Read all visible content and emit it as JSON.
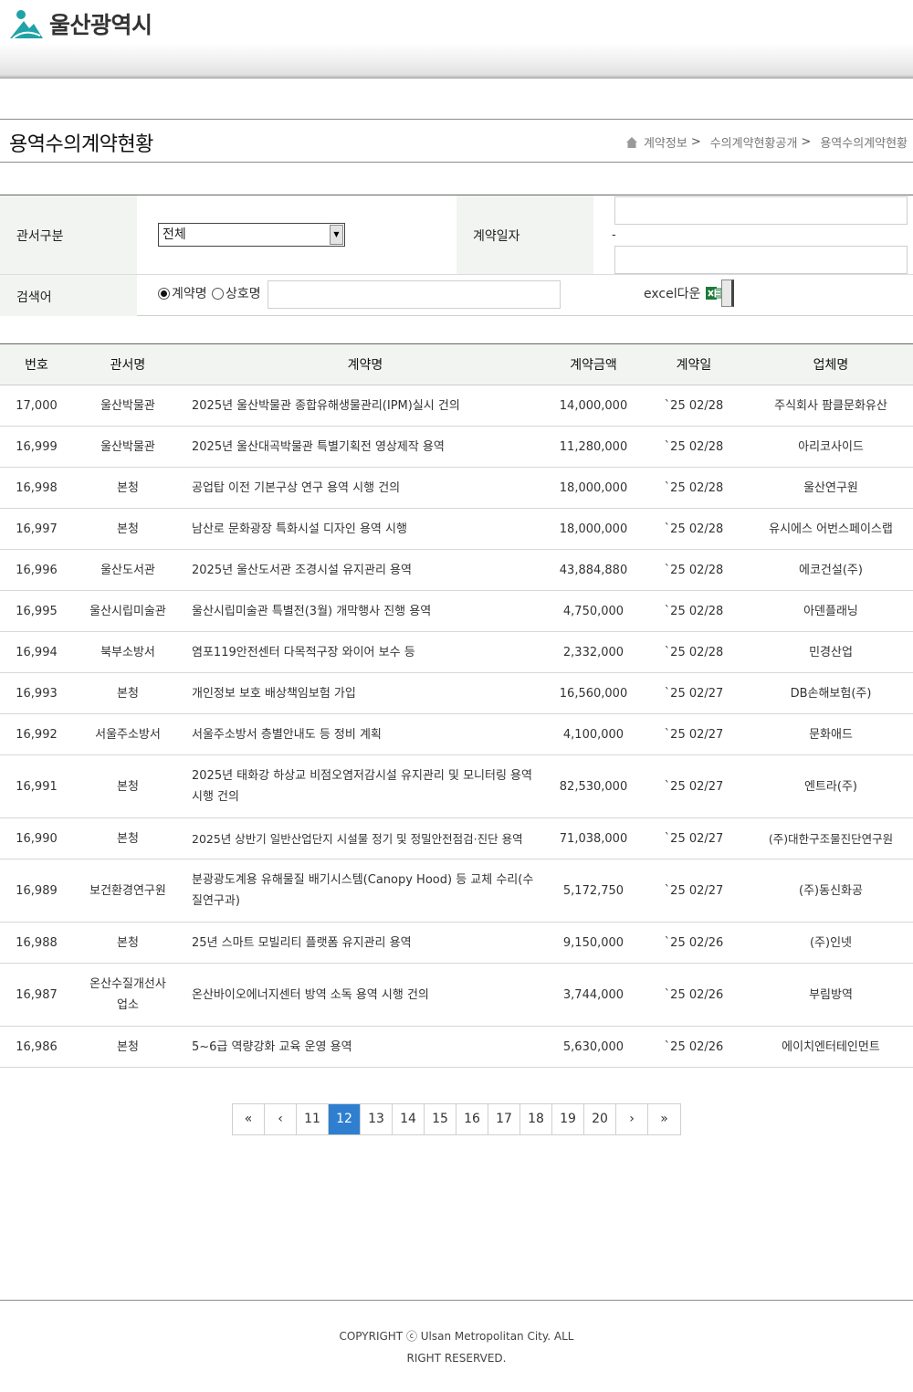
{
  "header": {
    "logo_text": "울산광역시"
  },
  "page": {
    "title": "용역수의계약현황",
    "breadcrumb": [
      "계약정보",
      "수의계약현황공개",
      "용역수의계약현황"
    ]
  },
  "search": {
    "dept_label": "관서구분",
    "dept_selected": "전체",
    "date_label": "계약일자",
    "date_separator": "-",
    "keyword_label": "검색어",
    "radio_contract": "계약명",
    "radio_company": "상호명",
    "excel_label": "excel다운"
  },
  "table": {
    "columns": [
      "번호",
      "관서명",
      "계약명",
      "계약금액",
      "계약일",
      "업체명"
    ],
    "rows": [
      {
        "no": "17,000",
        "dept": "울산박물관",
        "name": "2025년 울산박물관 종합유해생물관리(IPM)실시 건의",
        "amount": "14,000,000",
        "date": "`25 02/28",
        "company": "주식회사 팜클문화유산"
      },
      {
        "no": "16,999",
        "dept": "울산박물관",
        "name": "2025년 울산대곡박물관 특별기획전 영상제작 용역",
        "amount": "11,280,000",
        "date": "`25 02/28",
        "company": "아리코사이드"
      },
      {
        "no": "16,998",
        "dept": "본청",
        "name": "공업탑 이전 기본구상 연구 용역 시행 건의",
        "amount": "18,000,000",
        "date": "`25 02/28",
        "company": "울산연구원"
      },
      {
        "no": "16,997",
        "dept": "본청",
        "name": "남산로 문화광장 특화시설 디자인 용역 시행",
        "amount": "18,000,000",
        "date": "`25 02/28",
        "company": "유시에스 어번스페이스랩"
      },
      {
        "no": "16,996",
        "dept": "울산도서관",
        "name": "2025년 울산도서관 조경시설 유지관리 용역",
        "amount": "43,884,880",
        "date": "`25 02/28",
        "company": "에코건설(주)"
      },
      {
        "no": "16,995",
        "dept": "울산시립미술관",
        "name": "울산시립미술관 특별전(3월) 개막행사 진행 용역",
        "amount": "4,750,000",
        "date": "`25 02/28",
        "company": "아덴플래닝"
      },
      {
        "no": "16,994",
        "dept": "북부소방서",
        "name": "염포119안전센터 다목적구장 와이어 보수 등",
        "amount": "2,332,000",
        "date": "`25 02/28",
        "company": "민경산업"
      },
      {
        "no": "16,993",
        "dept": "본청",
        "name": "개인정보 보호 배상책임보험 가입",
        "amount": "16,560,000",
        "date": "`25 02/27",
        "company": "DB손해보험(주)"
      },
      {
        "no": "16,992",
        "dept": "서울주소방서",
        "name": "서울주소방서 층별안내도 등 정비 계획",
        "amount": "4,100,000",
        "date": "`25 02/27",
        "company": "문화애드"
      },
      {
        "no": "16,991",
        "dept": "본청",
        "name": "2025년 태화강 하상교 비점오염저감시설 유지관리 및 모니터링 용역 시행 건의",
        "amount": "82,530,000",
        "date": "`25 02/27",
        "company": "엔트라(주)"
      },
      {
        "no": "16,990",
        "dept": "본청",
        "name": "2025년 상반기 일반산업단지 시설물 정기 및 정밀안전점검·진단 용역",
        "amount": "71,038,000",
        "date": "`25 02/27",
        "company": "(주)대한구조물진단연구원"
      },
      {
        "no": "16,989",
        "dept": "보건환경연구원",
        "name": "분광광도계용 유해물질 배기시스템(Canopy Hood) 등 교체 수리(수질연구과)",
        "amount": "5,172,750",
        "date": "`25 02/27",
        "company": "(주)동신화공"
      },
      {
        "no": "16,988",
        "dept": "본청",
        "name": "25년 스마트 모빌리티 플랫폼 유지관리 용역",
        "amount": "9,150,000",
        "date": "`25 02/26",
        "company": "(주)인넷"
      },
      {
        "no": "16,987",
        "dept": "온산수질개선사업소",
        "name": "온산바이오에너지센터 방역 소독 용역 시행 건의",
        "amount": "3,744,000",
        "date": "`25 02/26",
        "company": "부림방역"
      },
      {
        "no": "16,986",
        "dept": "본청",
        "name": "5~6급 역량강화 교육 운영 용역",
        "amount": "5,630,000",
        "date": "`25 02/26",
        "company": "에이치엔터테인먼트"
      }
    ]
  },
  "pagination": {
    "first": "«",
    "prev": "‹",
    "next": "›",
    "last": "»",
    "pages": [
      "11",
      "12",
      "13",
      "14",
      "15",
      "16",
      "17",
      "18",
      "19",
      "20"
    ],
    "current": "12"
  },
  "footer": {
    "copyright": "COPYRIGHT ⓒ Ulsan Metropolitan City. ALL RIGHT RESERVED."
  },
  "colors": {
    "active_page": "#2f7fd0",
    "logo_teal": "#1fa3a8",
    "excel_green": "#1d7a3a"
  }
}
